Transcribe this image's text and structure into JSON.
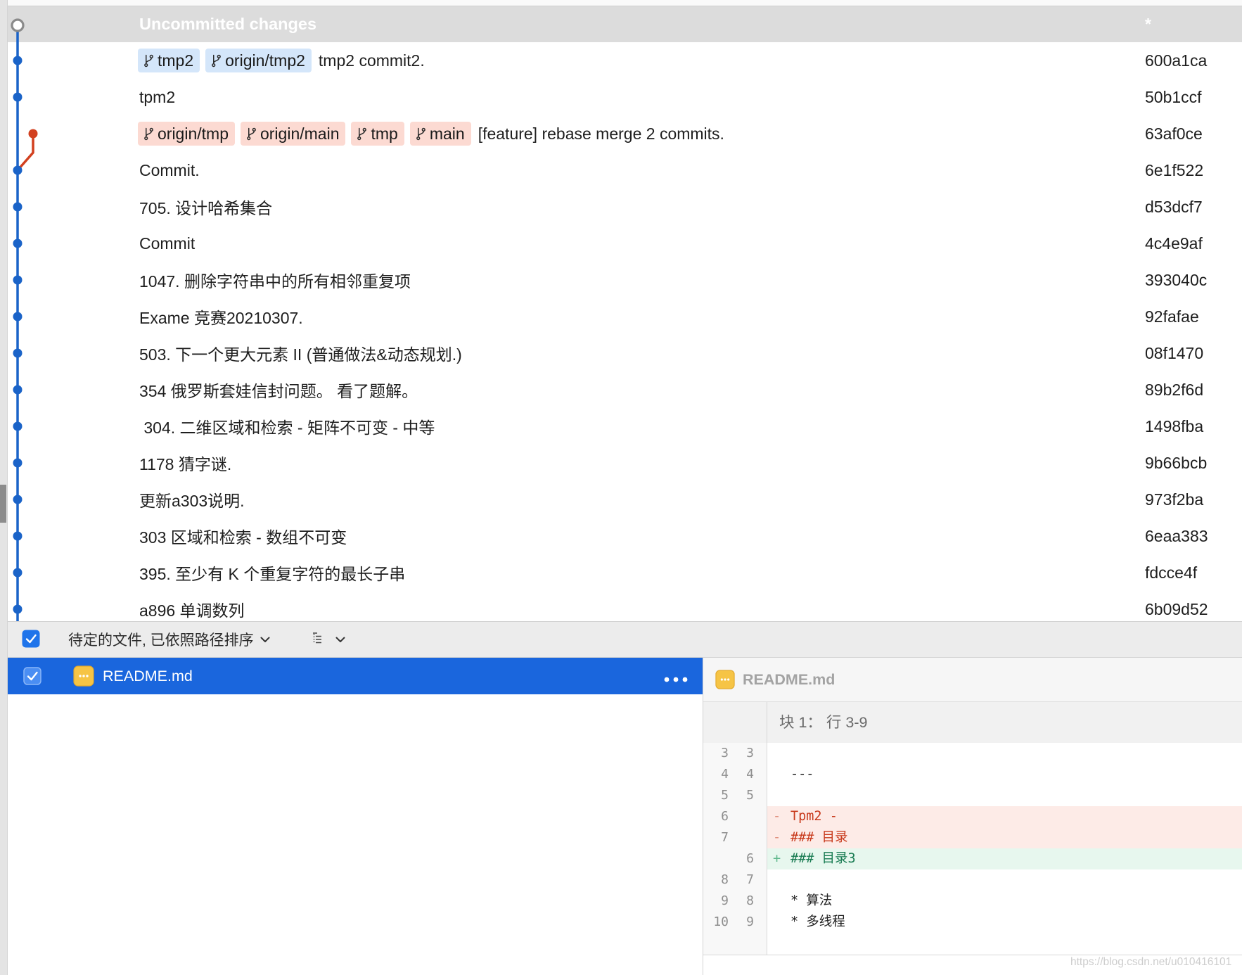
{
  "colors": {
    "lane_main": "#1a63c8",
    "uncommitted_ring": "#8a8a8a",
    "selection": "#1a66dd",
    "checkbox": "#1f74ea",
    "removed_bg": "#fdebe7",
    "added_bg": "#e7f7ee",
    "removed_text": "#c8391b",
    "added_text": "#167a50"
  },
  "uncommitted": {
    "label": "Uncommitted changes",
    "hash": "*"
  },
  "commits": [
    {
      "refs": [
        {
          "name": "tmp2"
        },
        {
          "name": "origin/tmp2"
        }
      ],
      "message": "tmp2 commit2.",
      "hash": "600a1ca",
      "lane": 0,
      "color": "#1a63c8",
      "badge_color": "#d4e6fa"
    },
    {
      "refs": [],
      "message": "tpm2",
      "hash": "50b1ccf",
      "lane": 0,
      "color": "#1a63c8",
      "badge_color": "#d4e6fa"
    },
    {
      "refs": [
        {
          "name": "origin/tmp"
        },
        {
          "name": "origin/main"
        },
        {
          "name": "tmp"
        },
        {
          "name": "main"
        }
      ],
      "message": "[feature] rebase merge 2 commits.",
      "hash": "63af0ce",
      "lane": 1,
      "color": "#d2401f",
      "badge_color": "#fcdad2"
    },
    {
      "refs": [],
      "message": "Commit.",
      "hash": "6e1f522",
      "lane": 0,
      "color": "#1a63c8",
      "badge_color": "#d4e6fa"
    },
    {
      "refs": [],
      "message": "705. 设计哈希集合",
      "hash": "d53dcf7",
      "lane": 0,
      "color": "#1a63c8",
      "badge_color": "#d4e6fa"
    },
    {
      "refs": [],
      "message": "Commit",
      "hash": "4c4e9af",
      "lane": 0,
      "color": "#1a63c8",
      "badge_color": "#d4e6fa"
    },
    {
      "refs": [],
      "message": "1047. 删除字符串中的所有相邻重复项",
      "hash": "393040c",
      "lane": 0,
      "color": "#1a63c8",
      "badge_color": "#d4e6fa"
    },
    {
      "refs": [],
      "message": "Exame 竞赛20210307.",
      "hash": "92fafae",
      "lane": 0,
      "color": "#1a63c8",
      "badge_color": "#d4e6fa"
    },
    {
      "refs": [],
      "message": "503. 下一个更大元素 II (普通做法&动态规划.)",
      "hash": "08f1470",
      "lane": 0,
      "color": "#1a63c8",
      "badge_color": "#d4e6fa"
    },
    {
      "refs": [],
      "message": "354 俄罗斯套娃信封问题。 看了题解。",
      "hash": "89b2f6d",
      "lane": 0,
      "color": "#1a63c8",
      "badge_color": "#d4e6fa"
    },
    {
      "refs": [],
      "message": " 304. 二维区域和检索 - 矩阵不可变 - 中等",
      "hash": "1498fba",
      "lane": 0,
      "color": "#1a63c8",
      "badge_color": "#d4e6fa"
    },
    {
      "refs": [],
      "message": "1178 猜字谜.",
      "hash": "9b66bcb",
      "lane": 0,
      "color": "#1a63c8",
      "badge_color": "#d4e6fa"
    },
    {
      "refs": [],
      "message": "更新a303说明.",
      "hash": "973f2ba",
      "lane": 0,
      "color": "#1a63c8",
      "badge_color": "#d4e6fa"
    },
    {
      "refs": [],
      "message": "303 区域和检索 - 数组不可变",
      "hash": "6eaa383",
      "lane": 0,
      "color": "#1a63c8",
      "badge_color": "#d4e6fa"
    },
    {
      "refs": [],
      "message": "395. 至少有 K 个重复字符的最长子串",
      "hash": "fdcce4f",
      "lane": 0,
      "color": "#1a63c8",
      "badge_color": "#d4e6fa"
    },
    {
      "refs": [],
      "message": "a896 单调数列",
      "hash": "6b09d52",
      "lane": 0,
      "color": "#1a63c8",
      "badge_color": "#d4e6fa"
    }
  ],
  "toolbar": {
    "stage_all_checked": true,
    "sort_label": "待定的文件, 已依照路径排序"
  },
  "files": [
    {
      "name": "README.md",
      "checked": true,
      "selected": true
    }
  ],
  "diff": {
    "file": "README.md",
    "hunk_header": "块 1： 行 3-9",
    "lines": [
      {
        "old": "3",
        "new": "3",
        "sign": "",
        "text": ""
      },
      {
        "old": "4",
        "new": "4",
        "sign": "",
        "text": "---"
      },
      {
        "old": "5",
        "new": "5",
        "sign": "",
        "text": ""
      },
      {
        "old": "6",
        "new": "",
        "sign": "-",
        "text": "Tpm2 -"
      },
      {
        "old": "7",
        "new": "",
        "sign": "-",
        "text": "### 目录"
      },
      {
        "old": "",
        "new": "6",
        "sign": "+",
        "text": "### 目录3"
      },
      {
        "old": "8",
        "new": "7",
        "sign": "",
        "text": ""
      },
      {
        "old": "9",
        "new": "8",
        "sign": "",
        "text": "* 算法"
      },
      {
        "old": "10",
        "new": "9",
        "sign": "",
        "text": "* 多线程"
      }
    ]
  },
  "watermark": "https://blog.csdn.net/u010416101"
}
